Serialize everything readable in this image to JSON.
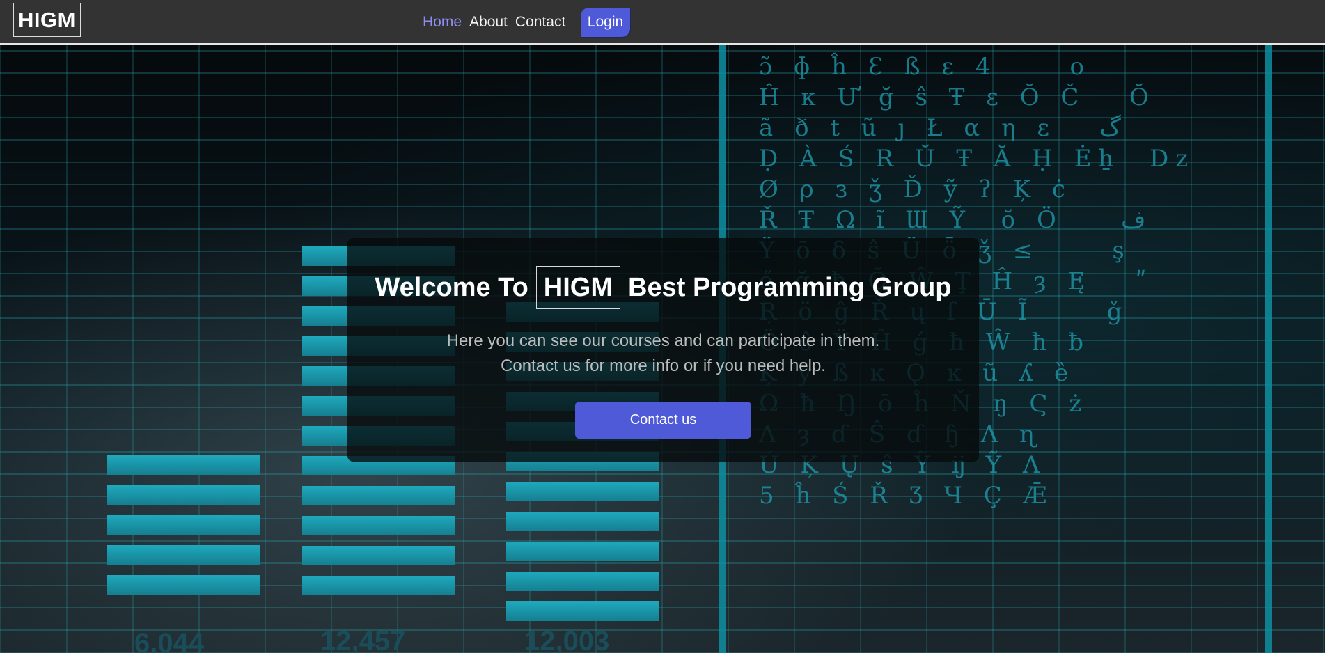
{
  "brand": {
    "logo": "HIGM"
  },
  "nav": {
    "links": [
      "Home",
      "About",
      "Contact"
    ],
    "active": "Home",
    "login_label": "Login"
  },
  "hero": {
    "headline_before": "Welcome To",
    "headline_highlight": "HIGM",
    "headline_after": "Best Programming Group",
    "description_line1": "Here you can see our courses and can participate in them.",
    "description_line2": "Contact us for more info or if you need help.",
    "cta_label": "Contact us"
  },
  "background": {
    "numbers": [
      "6,044",
      "12,457",
      "12,003"
    ]
  },
  "colors": {
    "navbar": "#333333",
    "accent": "#4f5ad9",
    "active_link": "#8f8cf2",
    "grid": "#28aab4"
  }
}
